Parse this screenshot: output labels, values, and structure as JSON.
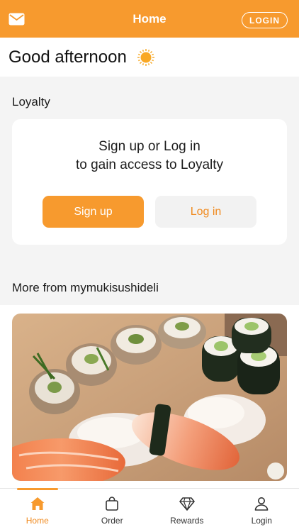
{
  "header": {
    "title": "Home",
    "login_label": "LOGIN",
    "mail_icon": "mail-icon"
  },
  "greeting": {
    "text": "Good afternoon",
    "icon": "sun-icon"
  },
  "loyalty": {
    "section_title": "Loyalty",
    "message_line1": "Sign up or Log in",
    "message_line2": "to gain access to Loyalty",
    "signup_label": "Sign up",
    "login_label": "Log in"
  },
  "more": {
    "section_title": "More from mymukisushideli",
    "image_subject": "sushi-platter-photo"
  },
  "tabs": [
    {
      "label": "Home",
      "icon": "home-icon",
      "active": true
    },
    {
      "label": "Order",
      "icon": "bag-icon",
      "active": false
    },
    {
      "label": "Rewards",
      "icon": "diamond-icon",
      "active": false
    },
    {
      "label": "Login",
      "icon": "user-icon",
      "active": false
    }
  ],
  "colors": {
    "brand": "#f79a2e",
    "brand_text": "#f08a1f",
    "background": "#f4f4f4"
  }
}
